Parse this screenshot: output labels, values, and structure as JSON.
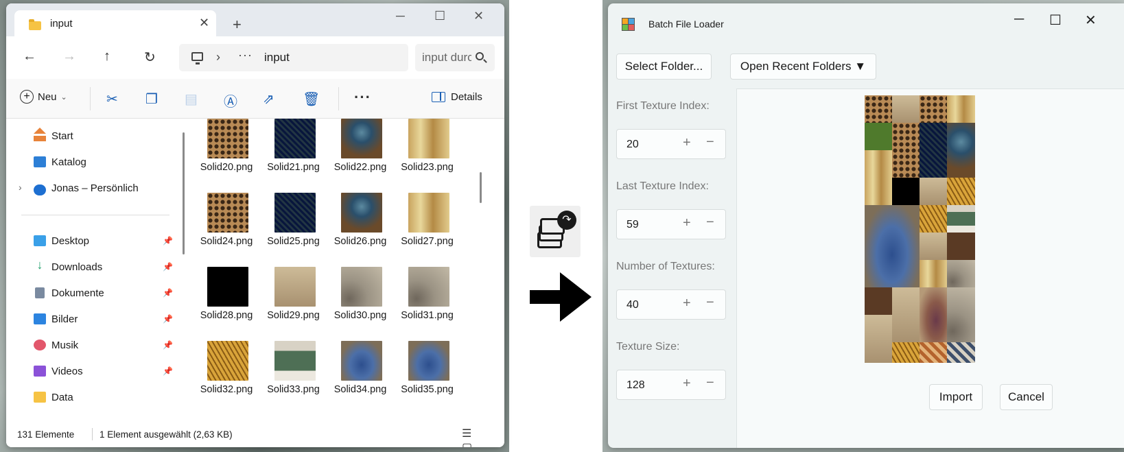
{
  "explorer": {
    "tab_title": "input",
    "new_tab": "+",
    "window_controls": {
      "minimize": "─",
      "maximize": "☐",
      "close": "✕"
    },
    "nav": {
      "back": "←",
      "forward": "→",
      "up": "↑",
      "refresh": "↻"
    },
    "address": {
      "separator": "›",
      "overflow": "···",
      "path": "input"
    },
    "search_placeholder": "input durchsuchen",
    "toolbar": {
      "new_label": "Neu",
      "details_label": "Details",
      "more": "···",
      "icons": [
        "scissors-icon",
        "copy-icon",
        "paste-icon",
        "rename-icon",
        "share-icon",
        "delete-icon"
      ]
    },
    "sidebar": {
      "quick": [
        {
          "label": "Start",
          "icon": "home-icon"
        },
        {
          "label": "Katalog",
          "icon": "gallery-icon"
        },
        {
          "label": "Jonas – Persönlich",
          "icon": "cloud-icon"
        }
      ],
      "pinned": [
        {
          "label": "Desktop",
          "icon": "desktop-icon",
          "pinned": true
        },
        {
          "label": "Downloads",
          "icon": "download-icon",
          "pinned": true
        },
        {
          "label": "Dokumente",
          "icon": "documents-icon",
          "pinned": true
        },
        {
          "label": "Bilder",
          "icon": "pictures-icon",
          "pinned": true
        },
        {
          "label": "Musik",
          "icon": "music-icon",
          "pinned": true
        },
        {
          "label": "Videos",
          "icon": "videos-icon",
          "pinned": true
        },
        {
          "label": "Data",
          "icon": "folder-icon",
          "pinned": false
        }
      ]
    },
    "files": [
      {
        "name": "Solid20.png",
        "pattern": "lattice"
      },
      {
        "name": "Solid21.png",
        "pattern": "blue"
      },
      {
        "name": "Solid22.png",
        "pattern": "mosaic"
      },
      {
        "name": "Solid23.png",
        "pattern": "arch"
      },
      {
        "name": "Solid24.png",
        "pattern": "lattice"
      },
      {
        "name": "Solid25.png",
        "pattern": "blue"
      },
      {
        "name": "Solid26.png",
        "pattern": "mosaic"
      },
      {
        "name": "Solid27.png",
        "pattern": "arch"
      },
      {
        "name": "Solid28.png",
        "pattern": "stained"
      },
      {
        "name": "Solid29.png",
        "pattern": "stone"
      },
      {
        "name": "Solid30.png",
        "pattern": "vault"
      },
      {
        "name": "Solid31.png",
        "pattern": "vault"
      },
      {
        "name": "Solid32.png",
        "pattern": "gold"
      },
      {
        "name": "Solid33.png",
        "pattern": "green"
      },
      {
        "name": "Solid34.png",
        "pattern": "window"
      },
      {
        "name": "Solid35.png",
        "pattern": "window"
      }
    ],
    "status": {
      "count": "131 Elemente",
      "selection": "1 Element ausgewählt (2,63 KB)",
      "view_icons": "☰ ▢"
    }
  },
  "transition": {
    "icon": "batch-import-icon",
    "arrow": "right-arrow-icon"
  },
  "loader": {
    "title": "Batch File Loader",
    "window_controls": {
      "minimize": "─",
      "maximize": "☐",
      "close": "✕"
    },
    "select_folder": "Select Folder...",
    "open_recent": "Open Recent Folders ▼",
    "fields": [
      {
        "label": "First Texture Index:",
        "value": "20"
      },
      {
        "label": "Last Texture Index:",
        "value": "59"
      },
      {
        "label": "Number of Textures:",
        "value": "40"
      },
      {
        "label": "Texture Size:",
        "value": "128"
      }
    ],
    "spin_plus": "+",
    "spin_minus": "−",
    "import": "Import",
    "cancel": "Cancel"
  }
}
